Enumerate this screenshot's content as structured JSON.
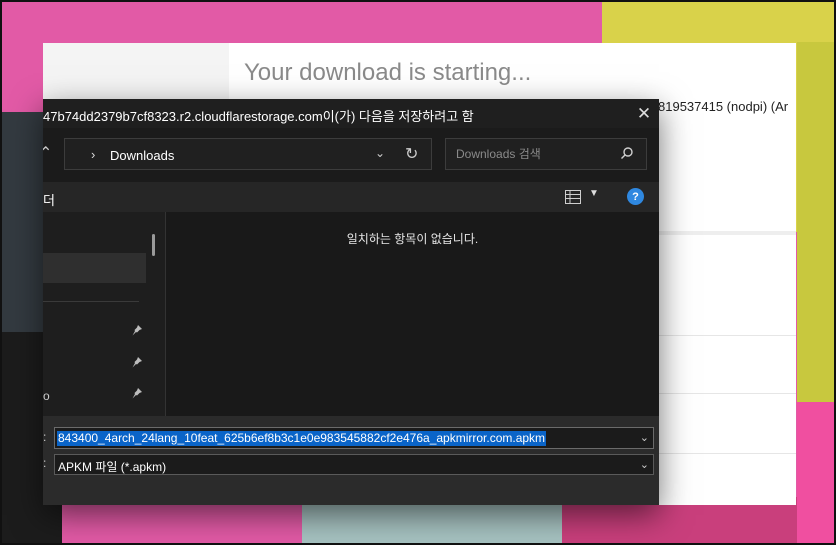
{
  "web": {
    "title": "Your download is starting...",
    "subtitle_fragment": "819537415 (nodpi) (Ar"
  },
  "dialog": {
    "title": "47b74dd2379b7cf8323.r2.cloudflarestorage.com이(가) 다음을 저장하려고 함",
    "close_icon": "close-icon",
    "address": {
      "path": "Downloads"
    },
    "search": {
      "placeholder": "Downloads 검색"
    },
    "command_bar": {
      "left_label": "더"
    },
    "nav_pane": {
      "partial_char": "o"
    },
    "content": {
      "empty_message": "일치하는 항목이 없습니다."
    },
    "file_name": {
      "label": ":",
      "value": "843400_4arch_24lang_10feat_625b6ef8b3c1e0e983545882cf2e476a_apkmirror.com.apkm"
    },
    "file_type": {
      "label": ":",
      "value": "APKM 파일 (*.apkm)"
    }
  },
  "colors": {
    "dialog_bg": "#1f1f1f",
    "selection": "#0a64c8",
    "help_accent": "#2f88e0",
    "web_title": "#8a8a8a"
  }
}
